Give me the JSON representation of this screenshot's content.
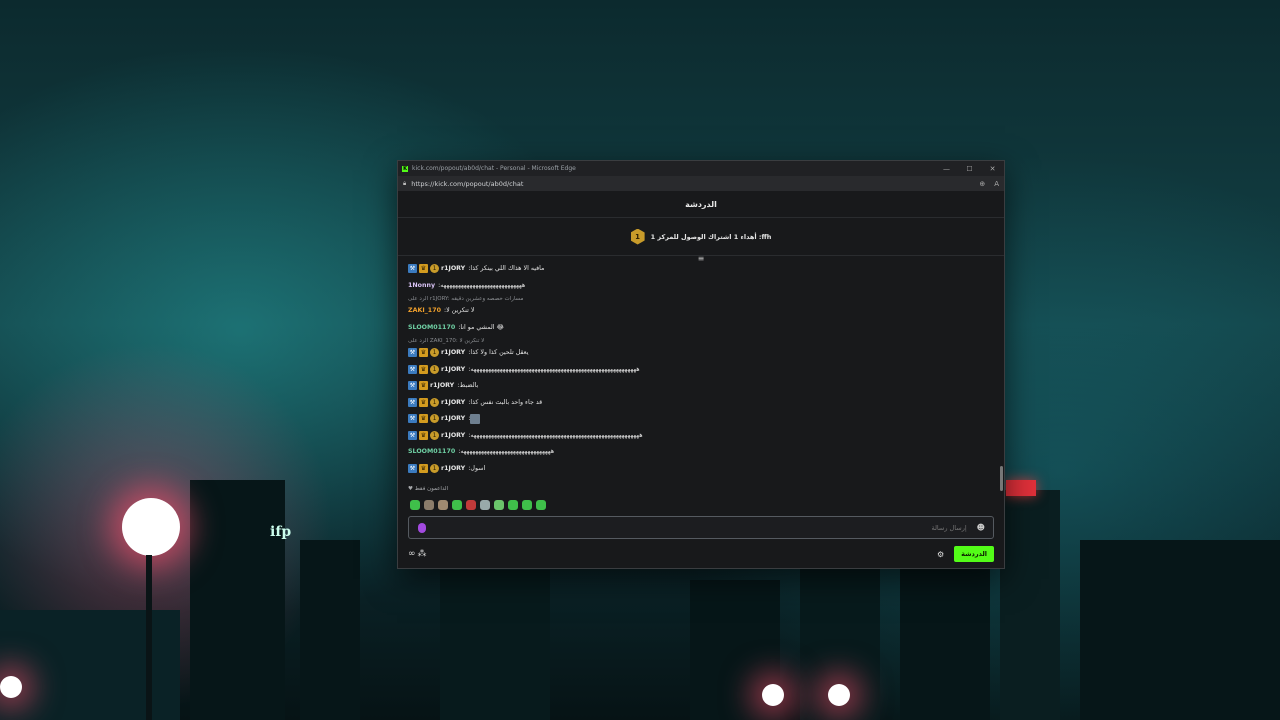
{
  "browser": {
    "title": "kick.com/popout/ab0d/chat - Personal - Microsoft Edge",
    "url": "https://kick.com/popout/ab0d/chat",
    "controls": {
      "minimize": "—",
      "maximize": "☐",
      "close": "✕"
    }
  },
  "chat": {
    "header": "الدردشة",
    "pinned": {
      "badge": "1",
      "text": "أهداء 1 اشتراك الوصول للمركز 1 :ffh"
    },
    "messages": [
      {
        "type": "msg",
        "badges": [
          "mod",
          "vip",
          "sub"
        ],
        "user": "r1JORY",
        "color": "#e6e6e6",
        "text": "مافيه الا هذاك اللي بينكر كذا"
      },
      {
        "type": "msg",
        "badges": [],
        "user": "1Nonny",
        "color": "#d9c3f5",
        "text": "ههههههههههههههههههههههههههههه"
      },
      {
        "type": "reply",
        "text": "الرد على r1JORY: مسارات خصصه وعشرين دقيقه"
      },
      {
        "type": "msg",
        "badges": [],
        "user": "ZAKI_170",
        "color": "#f0a02c",
        "text": "لا تنكرين لا"
      },
      {
        "type": "msg",
        "badges": [],
        "user": "SLOOM01170",
        "color": "#6fd0a4",
        "text": "المشي مو انا 😂"
      },
      {
        "type": "reply",
        "text": "الرد على ZAKI_170: لا تنكرين لا"
      },
      {
        "type": "msg",
        "badges": [
          "mod",
          "vip",
          "sub"
        ],
        "user": "r1JORY",
        "color": "#e6e6e6",
        "text": "يعقل تلحين كذا ولا كذا"
      },
      {
        "type": "msg",
        "badges": [
          "mod",
          "vip",
          "sub"
        ],
        "user": "r1JORY",
        "color": "#e6e6e6",
        "text": "هههههههههههههههههههههههههههههههههههههههههههههههههههههههههه"
      },
      {
        "type": "msg",
        "badges": [
          "mod",
          "vip"
        ],
        "user": "r1JORY",
        "color": "#e6e6e6",
        "text": "بالضبط"
      },
      {
        "type": "msg",
        "badges": [
          "mod",
          "vip",
          "sub"
        ],
        "user": "r1JORY",
        "color": "#e6e6e6",
        "text": "قد جاء واحد بالبث نفس كذا"
      },
      {
        "type": "msg",
        "badges": [
          "mod",
          "vip",
          "sub"
        ],
        "user": "r1JORY",
        "color": "#e6e6e6",
        "text": "",
        "emote": true
      },
      {
        "type": "msg",
        "badges": [
          "mod",
          "vip",
          "sub"
        ],
        "user": "r1JORY",
        "color": "#e6e6e6",
        "text": "ههههههههههههههههههههههههههههههههههههههههههههههههههههههههههه"
      },
      {
        "type": "msg",
        "badges": [],
        "user": "SLOOM01170",
        "color": "#6fd0a4",
        "text": "هههههههههههههههههههههههههههههههه"
      },
      {
        "type": "msg",
        "badges": [
          "mod",
          "vip",
          "sub"
        ],
        "user": "r1JORY",
        "color": "#e6e6e6",
        "text": "اسول"
      }
    ],
    "supporters_label": "الداعمون فقط",
    "emote_colors": [
      "#3fbf4a",
      "#8b7c6a",
      "#a08a70",
      "#3fbf4a",
      "#c23a3a",
      "#9aa",
      "#6ac46a",
      "#3fbf4a",
      "#3fbf4a",
      "#3fbf4a"
    ],
    "input_placeholder": "إرسال رسالة",
    "send_label": "الدردشة",
    "infinity": "∞",
    "users_icon": "⁂"
  },
  "desktop": {
    "sign_text": "ifp"
  }
}
